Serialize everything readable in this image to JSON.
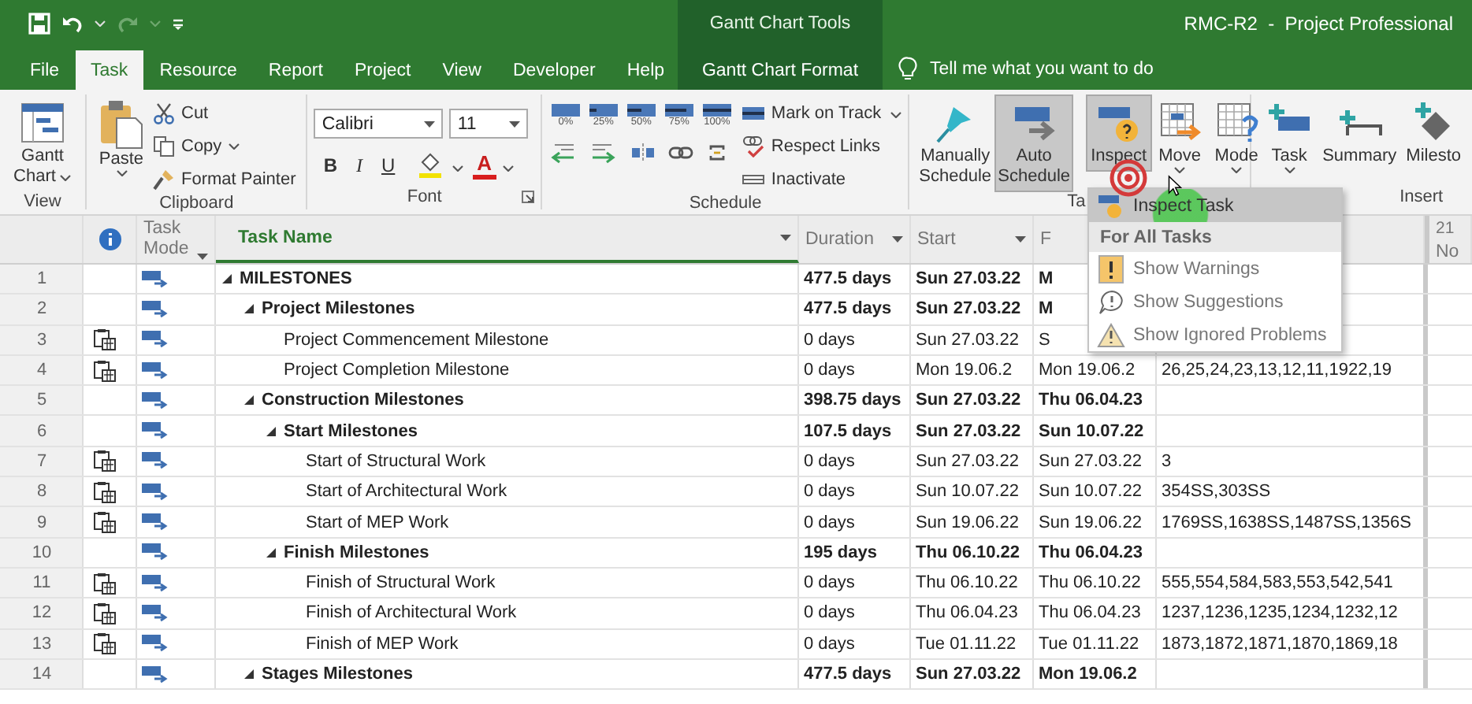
{
  "title_bar": {
    "contextual_group": "Gantt Chart Tools",
    "title": "RMC-R2  -  Project Professional"
  },
  "ribbon_tabs": [
    {
      "label": "File",
      "selected": false,
      "kind": "file"
    },
    {
      "label": "Task",
      "selected": true,
      "kind": "tab"
    },
    {
      "label": "Resource",
      "selected": false,
      "kind": "tab"
    },
    {
      "label": "Report",
      "selected": false,
      "kind": "tab"
    },
    {
      "label": "Project",
      "selected": false,
      "kind": "tab"
    },
    {
      "label": "View",
      "selected": false,
      "kind": "tab"
    },
    {
      "label": "Developer",
      "selected": false,
      "kind": "tab"
    },
    {
      "label": "Help",
      "selected": false,
      "kind": "tab"
    },
    {
      "label": "Gantt Chart Format",
      "selected": false,
      "kind": "contextual"
    }
  ],
  "tell_me": {
    "placeholder": "Tell me what you want to do"
  },
  "ribbon": {
    "view": {
      "label": "View",
      "gantt_chart": "Gantt Chart"
    },
    "clipboard": {
      "label": "Clipboard",
      "paste": "Paste",
      "cut": "Cut",
      "copy": "Copy",
      "format_painter": "Format Painter"
    },
    "font": {
      "label": "Font",
      "font_name": "Calibri",
      "font_size": "11",
      "bold": "B",
      "italic": "I",
      "underline": "U",
      "font_color": "A"
    },
    "schedule": {
      "label": "Schedule",
      "percent_labels": [
        "0%",
        "25%",
        "50%",
        "75%",
        "100%"
      ],
      "mark_on_track": "Mark on Track",
      "respect_links": "Respect Links",
      "inactivate": "Inactivate"
    },
    "tasks": {
      "label": "Ta",
      "buttons": [
        {
          "label": "Manually Schedule",
          "selected": false
        },
        {
          "label": "Auto Schedule",
          "selected": true
        },
        {
          "label": "Inspect",
          "selected": true
        },
        {
          "label": "Move",
          "selected": false
        },
        {
          "label": "Mode",
          "selected": false
        }
      ]
    },
    "insert": {
      "label": "Insert",
      "buttons": [
        "Task",
        "Summary",
        "Milesto"
      ]
    }
  },
  "table": {
    "columns": [
      {
        "label": "Task Mode",
        "filter_button": true
      },
      {
        "label": "Task Name",
        "filter_button": true
      },
      {
        "label": "Duration",
        "filter_button": true
      },
      {
        "label": "Start",
        "filter_button": true
      },
      {
        "label": "F",
        "filter_button": false
      }
    ],
    "timescale": [
      "21",
      "No"
    ],
    "rows": [
      {
        "id": "1",
        "indicator": false,
        "name": "MILESTONES",
        "summary": true,
        "expanded": true,
        "duration": "477.5 days",
        "start": "Sun 27.03.22",
        "finish": "M",
        "children": [
          {
            "id": "2",
            "indicator": false,
            "name": "Project Milestones",
            "summary": true,
            "expanded": true,
            "duration": "477.5 days",
            "start": "Sun 27.03.22",
            "finish": "M",
            "children": [
              {
                "id": "3",
                "indicator": true,
                "name": "Project Commencement Milestone",
                "summary": false,
                "duration": "0 days",
                "start": "Sun 27.03.22",
                "finish": "S"
              },
              {
                "id": "4",
                "indicator": true,
                "name": "Project Completion Milestone",
                "summary": false,
                "duration": "0 days",
                "start": "Mon 19.06.2",
                "finish": "Mon 19.06.2",
                "predecessors": "26,25,24,23,13,12,11,1922,19"
              }
            ]
          },
          {
            "id": "5",
            "indicator": false,
            "name": "Construction Milestones",
            "summary": true,
            "expanded": true,
            "duration": "398.75 days",
            "start": "Sun 27.03.22",
            "finish": "Thu 06.04.23",
            "children": [
              {
                "id": "6",
                "indicator": false,
                "name": "Start Milestones",
                "summary": true,
                "expanded": true,
                "duration": "107.5 days",
                "start": "Sun 27.03.22",
                "finish": "Sun 10.07.22",
                "children": [
                  {
                    "id": "7",
                    "indicator": true,
                    "name": "Start of Structural Work",
                    "summary": false,
                    "duration": "0 days",
                    "start": "Sun 27.03.22",
                    "finish": "Sun 27.03.22",
                    "predecessors": "3"
                  },
                  {
                    "id": "8",
                    "indicator": true,
                    "name": "Start of Architectural Work",
                    "summary": false,
                    "duration": "0 days",
                    "start": "Sun 10.07.22",
                    "finish": "Sun 10.07.22",
                    "predecessors": "354SS,303SS"
                  },
                  {
                    "id": "9",
                    "indicator": true,
                    "name": "Start of MEP Work",
                    "summary": false,
                    "duration": "0 days",
                    "start": "Sun 19.06.22",
                    "finish": "Sun 19.06.22",
                    "predecessors": "1769SS,1638SS,1487SS,1356S"
                  }
                ]
              },
              {
                "id": "10",
                "indicator": false,
                "name": "Finish Milestones",
                "summary": true,
                "expanded": true,
                "duration": "195 days",
                "start": "Thu 06.10.22",
                "finish": "Thu 06.04.23",
                "children": [
                  {
                    "id": "11",
                    "indicator": true,
                    "name": "Finish of Structural Work",
                    "summary": false,
                    "duration": "0 days",
                    "start": "Thu 06.10.22",
                    "finish": "Thu 06.10.22",
                    "predecessors": "555,554,584,583,553,542,541"
                  },
                  {
                    "id": "12",
                    "indicator": true,
                    "name": "Finish of Architectural Work",
                    "summary": false,
                    "duration": "0 days",
                    "start": "Thu 06.04.23",
                    "finish": "Thu 06.04.23",
                    "predecessors": "1237,1236,1235,1234,1232,12"
                  },
                  {
                    "id": "13",
                    "indicator": true,
                    "name": "Finish of MEP Work",
                    "summary": false,
                    "duration": "0 days",
                    "start": "Tue 01.11.22",
                    "finish": "Tue 01.11.22",
                    "predecessors": "1873,1872,1871,1870,1869,18"
                  }
                ]
              }
            ]
          },
          {
            "id": "14",
            "indicator": false,
            "name": "Stages Milestones",
            "summary": true,
            "expanded": true,
            "duration": "477.5 days",
            "start": "Sun 27.03.22",
            "finish": "Mon 19.06.2"
          }
        ]
      }
    ]
  },
  "inspect_menu": {
    "items": [
      {
        "kind": "item",
        "label": "Inspect Task",
        "selected": true
      },
      {
        "kind": "header",
        "label": "For All Tasks"
      },
      {
        "kind": "item",
        "label": "Show Warnings",
        "selected": false
      },
      {
        "kind": "item",
        "label": "Show Suggestions",
        "selected": false
      },
      {
        "kind": "item",
        "label": "Show Ignored Problems",
        "selected": false
      }
    ]
  }
}
